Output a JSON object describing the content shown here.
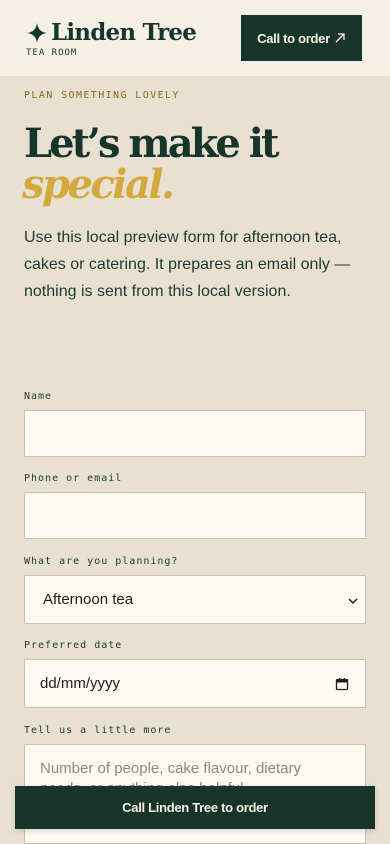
{
  "header": {
    "brand_name": "Linden Tree",
    "brand_sub": "TEA ROOM",
    "call_button": "Call to order",
    "call_icon": "arrow-up-right-icon",
    "logo_icon": "four-point-star-icon"
  },
  "hero": {
    "eyebrow": "PLAN SOMETHING LOVELY",
    "headline": "Let’s make it",
    "headline_accent": "special.",
    "intro": "Use this local preview form for afternoon tea, cakes or catering. It prepares an email only — nothing is sent from this local version."
  },
  "form": {
    "name_label": "Name",
    "name_value": "",
    "contact_label": "Phone or email",
    "contact_value": "",
    "plan_label": "What are you planning?",
    "plan_selected": "Afternoon tea",
    "date_label": "Preferred date",
    "date_placeholder": "dd/mm/yyyy",
    "more_label": "Tell us a little more",
    "more_placeholder": "Number of people, cake flavour, dietary needs, or anything else helpful"
  },
  "sticky_cta": {
    "label": "Call Linden Tree to order"
  },
  "colors": {
    "page_bg": "#e8e0d1",
    "header_bg": "#f5f0e6",
    "primary": "#17352b",
    "accent": "#d4a93e",
    "eyebrow": "#8a6a1e",
    "field_bg": "#fcfaf3"
  }
}
